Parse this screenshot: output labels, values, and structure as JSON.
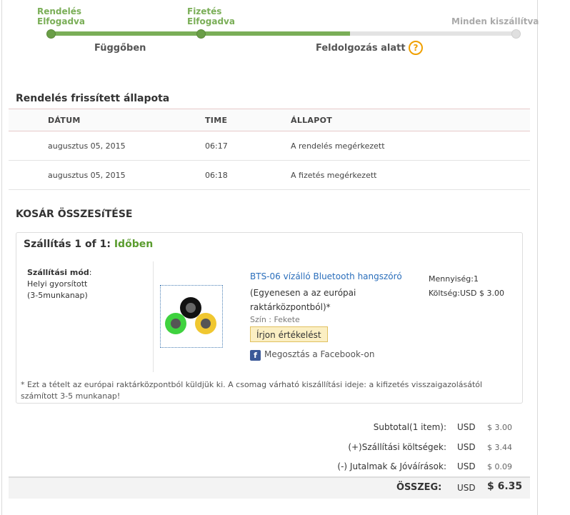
{
  "progress": {
    "step1": {
      "line1": "Rendelés",
      "line2": "Elfogadva"
    },
    "step2": {
      "line1": "Fizetés",
      "line2": "Elfogadva"
    },
    "step3": {
      "label": "Minden kiszállítva"
    },
    "stage1": "Függőben",
    "stage2": "Feldolgozás alatt",
    "fill_fraction": 0.65,
    "colors": {
      "done": "#7aae57",
      "pending": "#e3e3e3"
    }
  },
  "status_section": {
    "title": "Rendelés frissített állapota",
    "headers": [
      "DÁTUM",
      "TIME",
      "ÁLLAPOT"
    ],
    "rows": [
      [
        "augusztus 05, 2015",
        "06:17",
        "A rendelés megérkezett"
      ],
      [
        "augusztus 05, 2015",
        "06:18",
        "A fizetés megérkezett"
      ]
    ]
  },
  "cart": {
    "title": "KOSÁR ÖSSZESíTÉSE",
    "shipment_prefix": "Szállítás 1 of 1:",
    "shipment_status": "Időben",
    "method_label": "Szállítási mód",
    "method_colon": ":",
    "method_line1": "Helyi gyorsított",
    "method_line2": "(3-5munkanap)",
    "product_name": "BTS-06 vízálló Bluetooth hangszóró",
    "product_note": "(Egyenesen a az európai raktárközpontból)*",
    "product_color": "Szín : Fekete",
    "review_button": "Írjon értékelést",
    "facebook_share": "Megosztás a Facebook-on",
    "quantity": "Mennyiség:1",
    "cost": "Költség:USD $ 3.00",
    "footnote": "* Ezt a tételt az európai raktárközpontból küldjük ki. A csomag várható kiszállítási ideje: a kifizetés visszaigazolásától számított 3-5 munkanap!"
  },
  "totals": {
    "rows": [
      {
        "label": "Subtotal(1 item):",
        "currency": "USD",
        "value": "$ 3.00"
      },
      {
        "label": "(+)Szállítási költségek:",
        "currency": "USD",
        "value": "$ 3.44"
      },
      {
        "label": "(-) Jutalmak & Jóváírások:",
        "currency": "USD",
        "value": "$ 0.09"
      }
    ],
    "grand_label": "ÖSSZEG:",
    "grand_currency": "USD",
    "grand_value": "$ 6.35"
  },
  "icons": {
    "help": "question-circle-icon",
    "facebook": "facebook-icon"
  }
}
